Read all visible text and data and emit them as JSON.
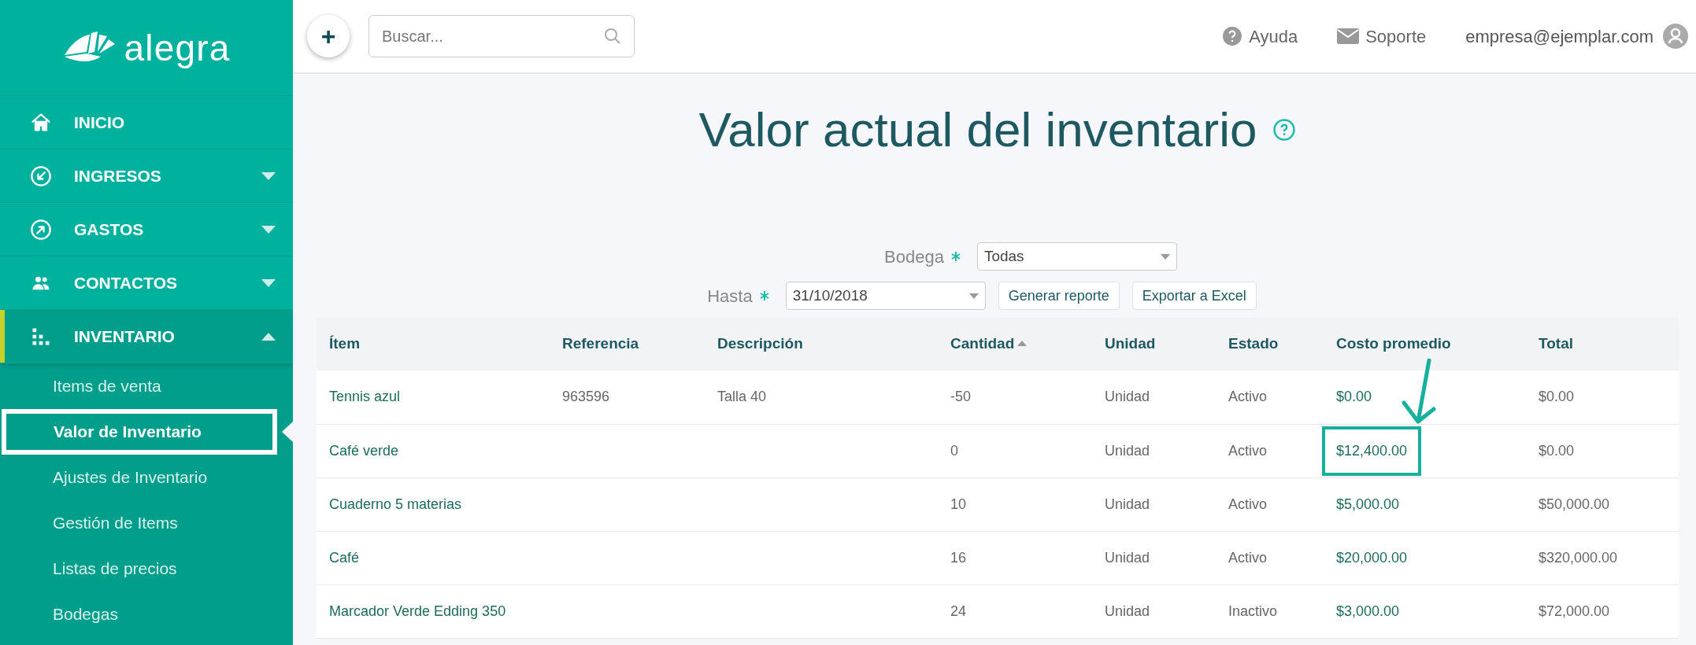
{
  "brand": "alegra",
  "sidebar": {
    "items": [
      {
        "label": "INICIO",
        "kind": "link",
        "selected": false
      },
      {
        "label": "INGRESOS",
        "kind": "menu",
        "selected": false,
        "expanded": false
      },
      {
        "label": "GASTOS",
        "kind": "menu",
        "selected": false,
        "expanded": false
      },
      {
        "label": "CONTACTOS",
        "kind": "menu",
        "selected": false,
        "expanded": false
      },
      {
        "label": "INVENTARIO",
        "kind": "menu",
        "selected": true,
        "expanded": true,
        "children": [
          {
            "label": "Items de venta",
            "selected": false
          },
          {
            "label": "Valor de Inventario",
            "selected": true
          },
          {
            "label": "Ajustes de Inventario",
            "selected": false
          },
          {
            "label": "Gestión de Items",
            "selected": false
          },
          {
            "label": "Listas de precios",
            "selected": false
          },
          {
            "label": "Bodegas",
            "selected": false
          }
        ]
      }
    ]
  },
  "header": {
    "add_button": "+",
    "search": {
      "placeholder": "Buscar..."
    },
    "links": [
      "Ayuda",
      "Soporte"
    ],
    "user": "empresa@ejemplar.com"
  },
  "page": {
    "title": "Valor actual del inventario",
    "filters": [
      {
        "label": "Bodega",
        "value": "Todas",
        "required": true
      },
      {
        "label": "Hasta",
        "value": "31/10/2018",
        "required": true
      }
    ],
    "buttons": [
      "Generar reporte",
      "Exportar a Excel"
    ]
  },
  "table": {
    "columns": [
      {
        "label": "Ítem",
        "sorted": false
      },
      {
        "label": "Referencia",
        "sorted": false
      },
      {
        "label": "Descripción",
        "sorted": false
      },
      {
        "label": "Cantidad",
        "sorted": true
      },
      {
        "label": "Unidad",
        "sorted": false
      },
      {
        "label": "Estado",
        "sorted": false
      },
      {
        "label": "Costo promedio",
        "sorted": false
      },
      {
        "label": "Total",
        "sorted": false
      }
    ],
    "rows": [
      {
        "cells": [
          "Tennis azul",
          "963596",
          "Talla 40",
          "-50",
          "Unidad",
          "Activo",
          "$0.00",
          "$0.00"
        ],
        "highlighted": false
      },
      {
        "cells": [
          "Café verde",
          "",
          "",
          "0",
          "Unidad",
          "Activo",
          "$12,400.00",
          "$0.00"
        ],
        "highlighted": true
      },
      {
        "cells": [
          "Cuaderno 5 materias",
          "",
          "",
          "10",
          "Unidad",
          "Activo",
          "$5,000.00",
          "$50,000.00"
        ],
        "highlighted": false
      },
      {
        "cells": [
          "Café",
          "",
          "",
          "16",
          "Unidad",
          "Activo",
          "$20,000.00",
          "$320,000.00"
        ],
        "highlighted": false
      },
      {
        "cells": [
          "Marcador Verde Edding 350",
          "",
          "",
          "24",
          "Unidad",
          "Inactivo",
          "$3,000.00",
          "$72,000.00"
        ],
        "highlighted": false
      }
    ]
  }
}
